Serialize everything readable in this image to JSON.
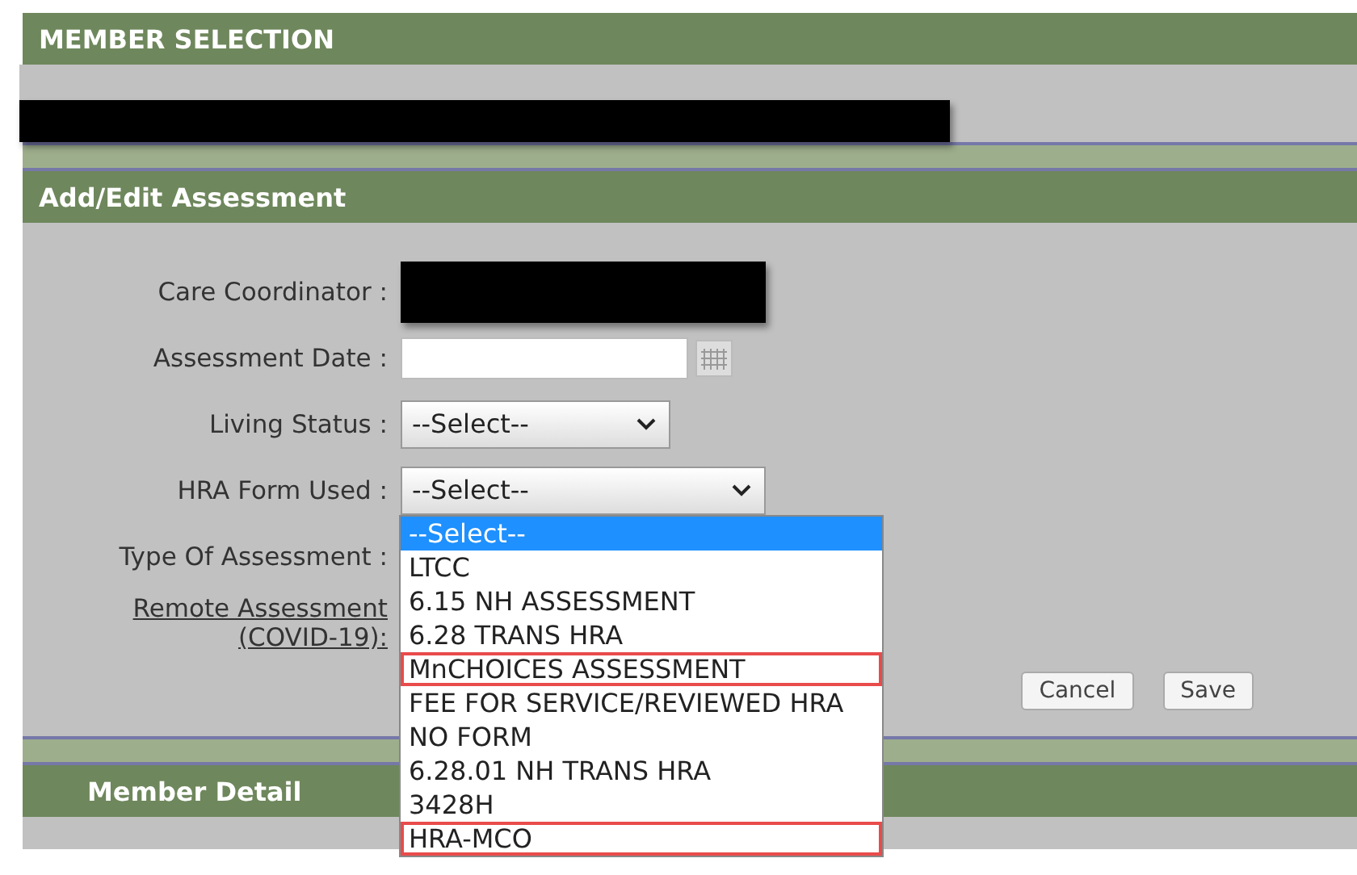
{
  "member_selection": {
    "title": "MEMBER SELECTION"
  },
  "assessment": {
    "title": "Add/Edit Assessment",
    "fields": [
      {
        "kind": "redacted",
        "label": "Care Coordinator :"
      },
      {
        "kind": "date",
        "label": "Assessment Date :"
      },
      {
        "kind": "select",
        "label": "Living Status :",
        "value": "--Select--"
      },
      {
        "kind": "select",
        "label": "HRA Form Used :",
        "value": "--Select--",
        "open": true,
        "options": [
          {
            "label": "--Select--",
            "selected": true,
            "highlighted": false
          },
          {
            "label": "LTCC",
            "selected": false,
            "highlighted": false
          },
          {
            "label": "6.15 NH ASSESSMENT",
            "selected": false,
            "highlighted": false
          },
          {
            "label": "6.28 TRANS HRA",
            "selected": false,
            "highlighted": false
          },
          {
            "label": "MnCHOICES ASSESSMENT",
            "selected": false,
            "highlighted": true
          },
          {
            "label": "FEE FOR SERVICE/REVIEWED HRA",
            "selected": false,
            "highlighted": false
          },
          {
            "label": "NO FORM",
            "selected": false,
            "highlighted": false
          },
          {
            "label": "6.28.01 NH TRANS HRA",
            "selected": false,
            "highlighted": false
          },
          {
            "label": "3428H",
            "selected": false,
            "highlighted": false
          },
          {
            "label": "HRA-MCO",
            "selected": false,
            "highlighted": true
          }
        ]
      },
      {
        "kind": "hidden",
        "label": "Type Of Assessment :"
      },
      {
        "kind": "link",
        "label": "Remote Assessment",
        "label_2": "(COVID-19):"
      }
    ],
    "buttons": [
      "Cancel",
      "Save"
    ]
  },
  "member_detail": {
    "title": "Member Detail"
  }
}
